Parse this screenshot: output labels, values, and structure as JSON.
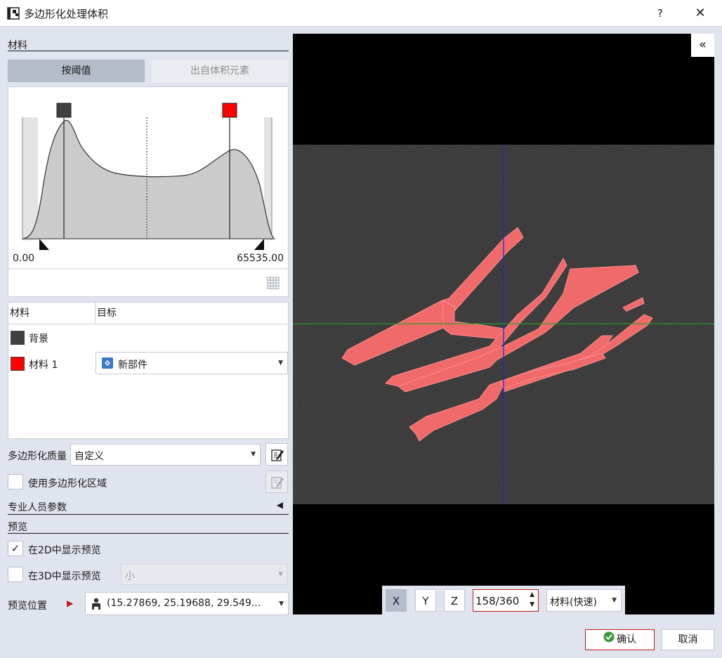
{
  "window": {
    "title": "多边形化处理体积",
    "help_label": "?",
    "close_label": "✕"
  },
  "material_section": {
    "heading": "材料",
    "tabs": [
      {
        "label": "按阈值",
        "active": true
      },
      {
        "label": "出自体积元素",
        "active": false
      }
    ],
    "histogram": {
      "min_label": "0.00",
      "max_label": "65535.00",
      "lower_threshold_color": "#404040",
      "upper_threshold_color": "#ff0000"
    },
    "table": {
      "columns": [
        "材料",
        "目标"
      ],
      "rows": [
        {
          "name": "背景",
          "color": "#404040",
          "target": ""
        },
        {
          "name": "材料 1",
          "color": "#ff0000",
          "target": "新部件"
        }
      ]
    }
  },
  "polygon_quality": {
    "label": "多边形化质量",
    "value": "自定义"
  },
  "use_region": {
    "label": "使用多边形化区域",
    "checked": false
  },
  "expert": {
    "label": "专业人员参数"
  },
  "preview": {
    "heading": "预览",
    "show_2d": {
      "label": "在2D中显示预览",
      "checked": true
    },
    "show_3d": {
      "label": "在3D中显示预览",
      "checked": false,
      "size": "小"
    },
    "position_label": "预览位置",
    "position_value": "(15.27869, 25.19688, 29.549..."
  },
  "viewer": {
    "collapse_label": "«",
    "axes": [
      "X",
      "Y",
      "Z"
    ],
    "active_axis": "X",
    "slice_value": "158/360",
    "render_mode": "材料(快速)"
  },
  "buttons": {
    "ok": "确认",
    "cancel": "取消"
  }
}
